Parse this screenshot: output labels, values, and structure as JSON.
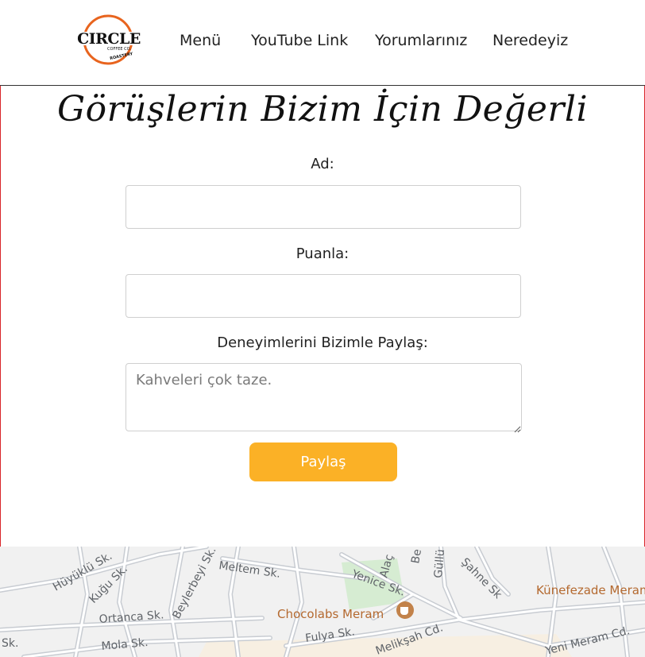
{
  "nav": {
    "logo_text": "CIRCLE",
    "logo_sub": "COFFEE CO.",
    "logo_tag": "ROASTERY",
    "links": [
      "Menü",
      "YouTube Link",
      "Yorumlarınız",
      "Neredeyiz"
    ]
  },
  "form": {
    "title": "Görüşlerin Bizim İçin Değerli",
    "name_label": "Ad:",
    "name_value": "",
    "rating_label": "Puanla:",
    "rating_value": "",
    "experience_label": "Deneyimlerini Bizimle Paylaş:",
    "experience_placeholder": "Kahveleri çok taze.",
    "submit_label": "Paylaş"
  },
  "map": {
    "streets": [
      "Hüyüklü Sk.",
      "Kuğu Sk.",
      "Beylerbeyi Sk.",
      "Meltem Sk.",
      "Ortanca Sk.",
      "Mola Sk.",
      "Yenice Sk.",
      "Alaç",
      "Be",
      "Güllü",
      "Şahne Sk",
      "Fulya Sk.",
      "Melikşah Cd.",
      "Yeni Meram Cd.",
      "Sk."
    ],
    "pois": [
      "Chocolabs Meram",
      "Künefezade Meram"
    ]
  },
  "colors": {
    "accent": "#fbb126",
    "logo_ring": "#e8641e",
    "frame": "#d9262b"
  }
}
